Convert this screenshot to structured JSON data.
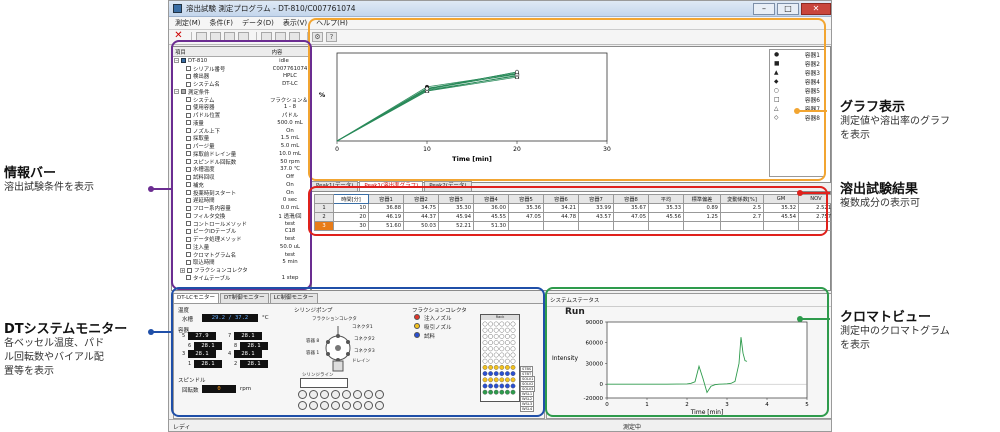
{
  "window": {
    "title": "溶出試験 測定プログラム - DT-810/C007761074",
    "menu": [
      "測定(M)",
      "条件(F)",
      "データ(D)",
      "表示(V)",
      "ヘルプ(H)"
    ],
    "status_left": "レディ",
    "status_center": "測定中"
  },
  "info": {
    "header": [
      "項目",
      "内容"
    ],
    "rows": [
      {
        "k": "DT-810",
        "v": "idle",
        "icon": "pc",
        "indent": 0,
        "exp": "−"
      },
      {
        "k": "シリアル番号",
        "v": "C007761074",
        "icon": "doc",
        "indent": 2
      },
      {
        "k": "検出器",
        "v": "HPLC",
        "icon": "doc",
        "indent": 2
      },
      {
        "k": "システム名",
        "v": "DT-LC",
        "icon": "doc",
        "indent": 2
      },
      {
        "k": "測定条件",
        "v": "",
        "icon": "grp",
        "indent": 0,
        "exp": "−"
      },
      {
        "k": "システム",
        "v": "フラクション＆インジェク...",
        "icon": "doc",
        "indent": 2
      },
      {
        "k": "使用容器",
        "v": "1 - 8",
        "icon": "doc",
        "indent": 2
      },
      {
        "k": "パドル位置",
        "v": "パドル",
        "icon": "doc",
        "indent": 2
      },
      {
        "k": "液量",
        "v": "500.0 mL",
        "icon": "doc",
        "indent": 2
      },
      {
        "k": "ノズル上下",
        "v": "On",
        "icon": "doc",
        "indent": 2
      },
      {
        "k": "採取量",
        "v": "1.5 mL",
        "icon": "doc",
        "indent": 2
      },
      {
        "k": "パージ量",
        "v": "5.0 mL",
        "icon": "doc",
        "indent": 2
      },
      {
        "k": "採取前ドレイン量",
        "v": "10.0 mL",
        "icon": "doc",
        "indent": 2
      },
      {
        "k": "スピンドル回転数",
        "v": "50 rpm",
        "icon": "doc",
        "indent": 2
      },
      {
        "k": "水槽温度",
        "v": "37.0 ℃",
        "icon": "doc",
        "indent": 2
      },
      {
        "k": "試料回収",
        "v": "Off",
        "icon": "doc",
        "indent": 2
      },
      {
        "k": "補充",
        "v": "On",
        "icon": "doc",
        "indent": 2
      },
      {
        "k": "投薬時刻スタート",
        "v": "On",
        "icon": "doc",
        "indent": 2
      },
      {
        "k": "遅延時間",
        "v": "0 sec",
        "icon": "doc",
        "indent": 2
      },
      {
        "k": "フロー系内容量",
        "v": "0.0 mL",
        "icon": "doc",
        "indent": 2
      },
      {
        "k": "フィルタ交換",
        "v": "1 透滑/回",
        "icon": "doc",
        "indent": 2
      },
      {
        "k": "コントロールメソッド",
        "v": "test",
        "icon": "doc",
        "indent": 2
      },
      {
        "k": "ピークIDテーブル",
        "v": "C18",
        "icon": "doc",
        "indent": 2
      },
      {
        "k": "データ処理メソッド",
        "v": "test",
        "icon": "doc",
        "indent": 2
      },
      {
        "k": "注入量",
        "v": "50.0 uL",
        "icon": "doc",
        "indent": 2
      },
      {
        "k": "クロマトグラム名",
        "v": "test",
        "icon": "doc",
        "indent": 2
      },
      {
        "k": "取込時間",
        "v": "5 min",
        "icon": "doc",
        "indent": 2
      },
      {
        "k": "フラクションコレクタ",
        "v": "",
        "icon": "doc",
        "indent": 1,
        "exp": "+"
      },
      {
        "k": "タイムテーブル",
        "v": "1 step",
        "icon": "doc",
        "indent": 2
      }
    ]
  },
  "chart_data": [
    {
      "type": "line",
      "xlabel": "Time [min]",
      "ylabel": "%",
      "xlim": [
        0,
        30
      ],
      "ylim": [
        0,
        60
      ],
      "xticks": [
        0,
        10,
        20,
        30
      ],
      "grid": false,
      "legend_position": "right",
      "series": [
        {
          "name": "容器1",
          "marker": "circle",
          "x": [
            0,
            10,
            20
          ],
          "y": [
            0,
            36.88,
            46.19
          ]
        },
        {
          "name": "容器2",
          "marker": "square",
          "x": [
            0,
            10,
            20
          ],
          "y": [
            0,
            34.75,
            44.37
          ]
        },
        {
          "name": "容器3",
          "marker": "triangle",
          "x": [
            0,
            10,
            20
          ],
          "y": [
            0,
            35.3,
            45.94
          ]
        },
        {
          "name": "容器4",
          "marker": "diamond",
          "x": [
            0,
            10,
            20
          ],
          "y": [
            0,
            36.0,
            45.55
          ]
        },
        {
          "name": "容器5",
          "marker": "circle-open",
          "x": [
            0,
            10,
            20
          ],
          "y": [
            0,
            35.36,
            47.05
          ]
        },
        {
          "name": "容器6",
          "marker": "square-open",
          "x": [
            0,
            10,
            20
          ],
          "y": [
            0,
            34.21,
            44.78
          ]
        },
        {
          "name": "容器7",
          "marker": "triangle-open",
          "x": [
            0,
            10,
            20
          ],
          "y": [
            0,
            33.99,
            43.57
          ]
        },
        {
          "name": "容器8",
          "marker": "diamond-open",
          "x": [
            0,
            10,
            20
          ],
          "y": [
            0,
            35.67,
            47.05
          ]
        }
      ]
    },
    {
      "type": "line",
      "title": "Run",
      "xlabel": "Time [min]",
      "ylabel": "Intensity",
      "xlim": [
        0,
        5
      ],
      "ylim": [
        -20000,
        90000
      ],
      "xticks": [
        0,
        1,
        2,
        3,
        4,
        5
      ],
      "yticks": [
        -20000,
        0,
        30000,
        60000,
        90000
      ],
      "ytick_labels": [
        "-20000",
        "0",
        "30000",
        "60000",
        "90000"
      ],
      "series": [
        {
          "x": [
            0,
            0.5,
            1,
            1.5,
            2,
            2.1,
            2.2,
            2.3,
            2.4,
            2.5,
            2.6,
            2.7,
            2.8,
            2.9,
            3.0,
            3.1,
            3.2,
            3.3,
            3.35,
            3.4,
            3.45,
            3.5
          ],
          "y": [
            0,
            0,
            0,
            0,
            400,
            1200,
            3500,
            26000,
            8000,
            -12000,
            -3000,
            -800,
            0,
            200,
            500,
            1200,
            4000,
            30000,
            68000,
            45000,
            34000,
            33000
          ]
        }
      ]
    }
  ],
  "results": {
    "tabs": [
      "Peak1(データ)",
      "Peak1(溶出率グラフ)",
      "Peak2(データ)"
    ],
    "headers": [
      "",
      "時間[分]",
      "容器1",
      "容器2",
      "容器3",
      "容器4",
      "容器5",
      "容器6",
      "容器7",
      "容器8",
      "平均",
      "標準偏差",
      "変動係数[%]",
      "GM",
      "NOV"
    ],
    "rows": [
      [
        "1",
        "10",
        "36.88",
        "34.75",
        "35.30",
        "36.00",
        "35.36",
        "34.21",
        "33.99",
        "35.67",
        "35.33",
        "0.89",
        "2.5",
        "35.32",
        "2.521"
      ],
      [
        "2",
        "20",
        "46.19",
        "44.37",
        "45.94",
        "45.55",
        "47.05",
        "44.78",
        "43.57",
        "47.05",
        "45.56",
        "1.25",
        "2.7",
        "45.54",
        "2.757"
      ],
      [
        "3",
        "30",
        "51.60",
        "50.03",
        "52.21",
        "51.30",
        "",
        "",
        "",
        "",
        "",
        "",
        "",
        "",
        ""
      ]
    ]
  },
  "monitor": {
    "tabs": [
      "DT-LCモニター",
      "DT制御モニター",
      "LC制御モニター"
    ],
    "temp_label": "温度",
    "bath_label": "水槽",
    "bath_value": "29.2 / 37.2",
    "bath_unit": "°C",
    "vessel_label": "容器",
    "vessels": [
      {
        "n": "5",
        "v": "27.9"
      },
      {
        "n": "7",
        "v": "28.1"
      },
      {
        "n": "6",
        "v": "28.1"
      },
      {
        "n": "8",
        "v": "28.1"
      },
      {
        "n": "3",
        "v": "28.1"
      },
      {
        "n": "4",
        "v": "28.1"
      },
      {
        "n": "1",
        "v": "28.1"
      },
      {
        "n": "2",
        "v": "28.1"
      }
    ],
    "spindle_label": "スピンドル",
    "rpm_label": "回転数",
    "rpm_value": "0",
    "rpm_unit": "rpm",
    "pump_label": "シリンジポンプ",
    "pump_parts": [
      "フラクションコレクタ",
      "コネクタ1",
      "コネクタ2",
      "コネクタ3",
      "容器 8",
      "容器 1",
      "ドレイン"
    ],
    "syringe_line_label": "シリンジライン",
    "fraction_label": "フラクションコレクタ",
    "legend": [
      {
        "label": "注入ノズル",
        "color": "#e0372b"
      },
      {
        "label": "吸引ノズル",
        "color": "#f2c11e"
      },
      {
        "label": "試料",
        "color": "#2a4fd1"
      }
    ],
    "rack_label": "Rack",
    "rack_items": [
      "STBS",
      "STBT",
      "SOLV1",
      "SOLV2",
      "SOLV3",
      "WSL1",
      "WSL2",
      "WSL3",
      "WSL4"
    ]
  },
  "system": {
    "header": "システムステータス"
  },
  "callouts": {
    "graph": {
      "title": "グラフ表示",
      "desc": [
        "測定値や溶出率のグラフ",
        "を表示"
      ]
    },
    "info": {
      "title": "情報バー",
      "desc": [
        "溶出試験条件を表示"
      ]
    },
    "result": {
      "title": "溶出試験結果",
      "desc": [
        "複数成分の表示可"
      ]
    },
    "dt": {
      "title": "DTシステムモニター",
      "desc": [
        "各ベッセル温度、パド",
        "ル回転数やバイアル配",
        "置等を表示"
      ]
    },
    "chrom": {
      "title": "クロマトビュー",
      "desc": [
        "測定中のクロマトグラム",
        "を表示"
      ]
    }
  },
  "colors": {
    "graph_frame": "#f2a531",
    "info_frame": "#6b2d91",
    "result_frame": "#e0211c",
    "dt_frame": "#1f4fa8",
    "chrom_frame": "#2e9b4c",
    "series_line": "#2a8a5a"
  }
}
